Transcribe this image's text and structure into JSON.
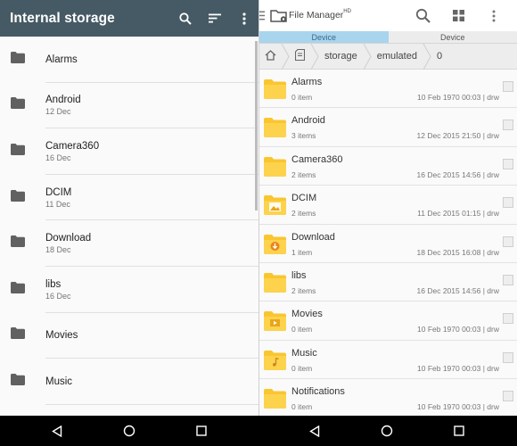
{
  "left": {
    "title": "Internal storage",
    "header_color": "#455a64",
    "icons": [
      "search-icon",
      "sort-icon",
      "more-vert-icon"
    ],
    "items": [
      {
        "name": "Alarms",
        "date": ""
      },
      {
        "name": "Android",
        "date": "12 Dec"
      },
      {
        "name": "Camera360",
        "date": "16 Dec"
      },
      {
        "name": "DCIM",
        "date": "11 Dec"
      },
      {
        "name": "Download",
        "date": "18 Dec"
      },
      {
        "name": "libs",
        "date": "16 Dec"
      },
      {
        "name": "Movies",
        "date": ""
      },
      {
        "name": "Music",
        "date": ""
      }
    ]
  },
  "right": {
    "app_title": "File Manager",
    "app_title_sup": "HD",
    "icons": [
      "search-icon",
      "grid-view-icon",
      "more-vert-icon"
    ],
    "tabs": [
      {
        "label": "Device",
        "active": true
      },
      {
        "label": "Device",
        "active": false
      }
    ],
    "breadcrumb": [
      "storage",
      "emulated",
      "0"
    ],
    "accent": "#a8d4ee",
    "folder_color": "#f9c630",
    "items": [
      {
        "name": "Alarms",
        "sub": "0 item",
        "meta": "10 Feb 1970 00:03 | drw",
        "icon": "folder-icon"
      },
      {
        "name": "Android",
        "sub": "3 items",
        "meta": "12 Dec 2015 21:50 | drw",
        "icon": "folder-icon"
      },
      {
        "name": "Camera360",
        "sub": "2 items",
        "meta": "16 Dec 2015 14:56 | drw",
        "icon": "folder-icon"
      },
      {
        "name": "DCIM",
        "sub": "2 items",
        "meta": "11 Dec 2015 01:15 | drw",
        "icon": "folder-image-icon"
      },
      {
        "name": "Download",
        "sub": "1 item",
        "meta": "18 Dec 2015 16:08 | drw",
        "icon": "folder-download-icon"
      },
      {
        "name": "libs",
        "sub": "2 items",
        "meta": "16 Dec 2015 14:56 | drw",
        "icon": "folder-icon"
      },
      {
        "name": "Movies",
        "sub": "0 item",
        "meta": "10 Feb 1970 00:03 | drw",
        "icon": "folder-video-icon"
      },
      {
        "name": "Music",
        "sub": "0 item",
        "meta": "10 Feb 1970 00:03 | drw",
        "icon": "folder-music-icon"
      },
      {
        "name": "Notifications",
        "sub": "0 item",
        "meta": "10 Feb 1970 00:03 | drw",
        "icon": "folder-icon"
      }
    ]
  },
  "navbar": {
    "icons": [
      "back-icon",
      "home-icon",
      "recents-icon",
      "back-icon",
      "home-icon",
      "recents-icon"
    ]
  }
}
